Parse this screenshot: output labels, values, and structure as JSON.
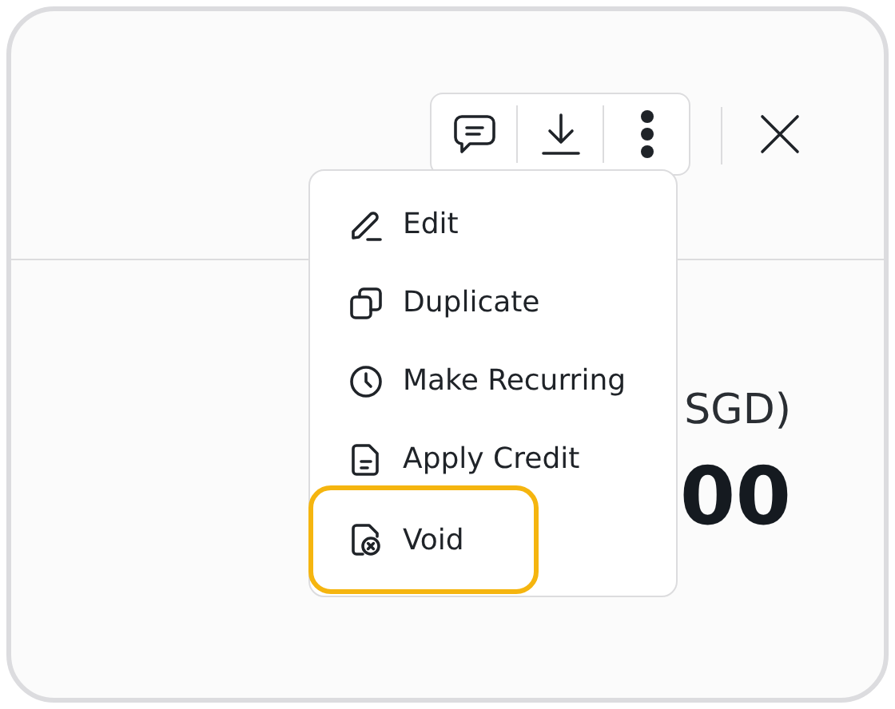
{
  "toolbar": {
    "buttons": [
      {
        "kind": "comment"
      },
      {
        "kind": "download"
      },
      {
        "kind": "more"
      }
    ]
  },
  "close": {
    "kind": "close"
  },
  "amount": {
    "currency_label": "SGD)",
    "value": "00"
  },
  "menu": {
    "items": [
      {
        "label": "Edit",
        "kind": "edit",
        "selected": false
      },
      {
        "label": "Duplicate",
        "kind": "duplicate",
        "selected": false
      },
      {
        "label": "Make Recurring",
        "kind": "recurring",
        "selected": false
      },
      {
        "label": "Apply Credit",
        "kind": "credit",
        "selected": false
      },
      {
        "label": "Void",
        "kind": "void",
        "selected": true
      }
    ]
  }
}
